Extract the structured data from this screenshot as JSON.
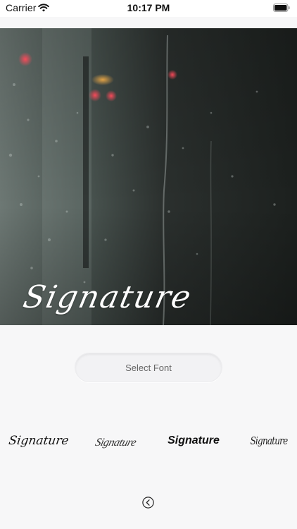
{
  "status_bar": {
    "carrier": "Carrier",
    "time": "10:17 PM",
    "icons": [
      "wifi-icon",
      "battery-icon"
    ]
  },
  "preview": {
    "signature_text": "Signature",
    "background_description_icon": "rainy-window-photo"
  },
  "select_font": {
    "label": "Select Font"
  },
  "font_samples": [
    {
      "label": "Signature"
    },
    {
      "label": "Signature"
    },
    {
      "label": "Signature"
    },
    {
      "label": "Signature"
    }
  ],
  "navigation": {
    "back_icon": "chevron-left-circle-icon"
  },
  "colors": {
    "background": "#f7f7f8",
    "signature_overlay": "#ffffff",
    "button_text": "#666666"
  }
}
